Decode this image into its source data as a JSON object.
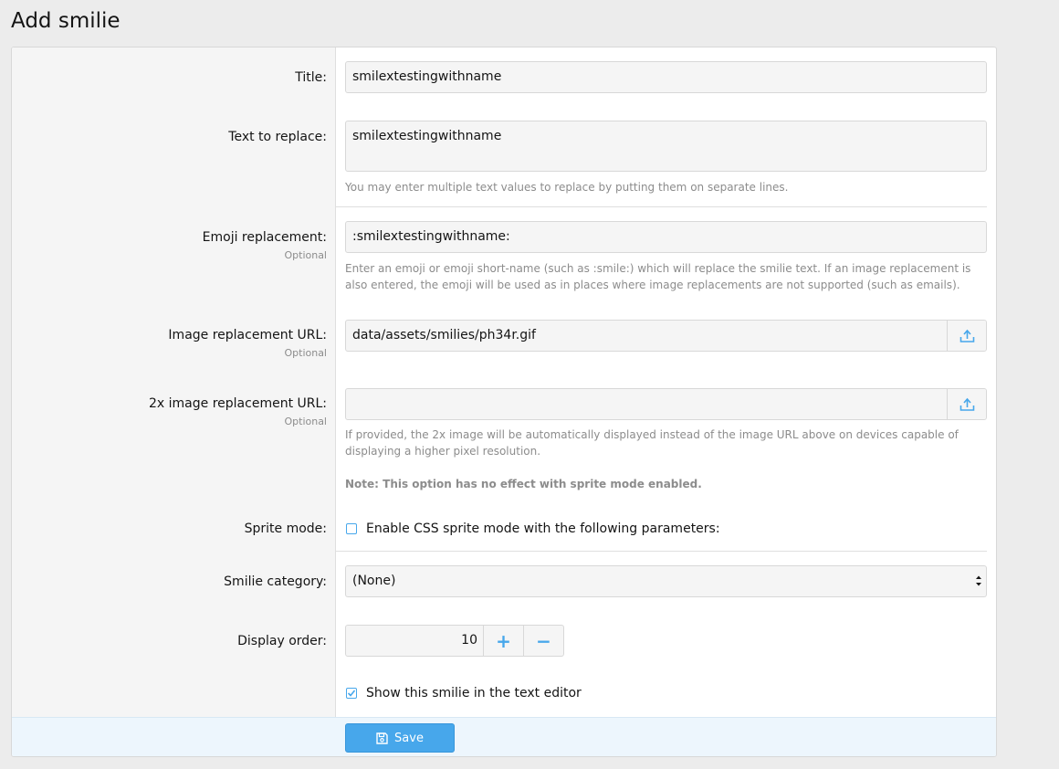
{
  "page": {
    "title": "Add smilie"
  },
  "form": {
    "title": {
      "label": "Title:",
      "value": "smilextestingwithname"
    },
    "text_to_replace": {
      "label": "Text to replace:",
      "value": "smilextestingwithname",
      "explain": "You may enter multiple text values to replace by putting them on separate lines."
    },
    "emoji": {
      "label": "Emoji replacement:",
      "hint": "Optional",
      "value": ":smilextestingwithname:",
      "explain": "Enter an emoji or emoji short-name (such as :smile:) which will replace the smilie text. If an image replacement is also entered, the emoji will be used as in places where image replacements are not supported (such as emails)."
    },
    "image_url": {
      "label": "Image replacement URL:",
      "hint": "Optional",
      "value": "data/assets/smilies/ph34r.gif"
    },
    "image_url_2x": {
      "label": "2x image replacement URL:",
      "hint": "Optional",
      "value": "",
      "explain": "If provided, the 2x image will be automatically displayed instead of the image URL above on devices capable of displaying a higher pixel resolution.",
      "note": "Note: This option has no effect with sprite mode enabled."
    },
    "sprite_mode": {
      "label": "Sprite mode:",
      "checkbox_label": "Enable CSS sprite mode with the following parameters:",
      "checked": false
    },
    "category": {
      "label": "Smilie category:",
      "selected": "(None)"
    },
    "display_order": {
      "label": "Display order:",
      "value": "10",
      "plus": "+",
      "minus": "−"
    },
    "show_in_editor": {
      "checkbox_label": "Show this smilie in the text editor",
      "checked": true
    }
  },
  "footer": {
    "save_label": "Save"
  },
  "colors": {
    "accent": "#47a7eb",
    "footer_bg": "#edf6fd",
    "label_bg": "#f5f5f5"
  }
}
